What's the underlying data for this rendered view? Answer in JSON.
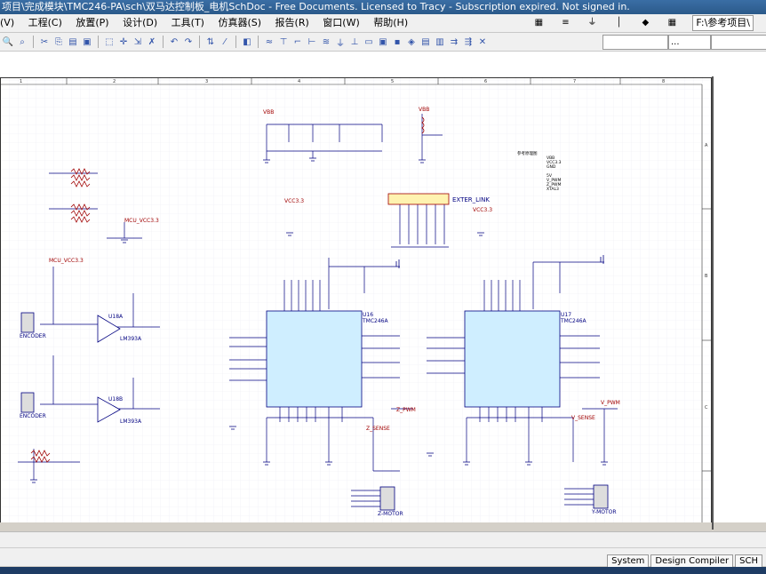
{
  "title": "项目\\完成模块\\TMC246-PA\\sch\\双马达控制板_电机SchDoc - Free Documents. Licensed to Tracy - Subscription expired. Not signed in.",
  "menu": [
    "(V)",
    "工程(C)",
    "放置(P)",
    "设计(D)",
    "工具(T)",
    "仿真器(S)",
    "报告(R)",
    "窗口(W)",
    "帮助(H)"
  ],
  "path_box": "F:\\参考项目\\",
  "combos": [
    "",
    "..."
  ],
  "sheet": {
    "col_numbers": [
      "1",
      "2",
      "3",
      "4",
      "5",
      "6",
      "7",
      "8"
    ],
    "row_letters": [
      "A",
      "B",
      "C"
    ],
    "exter_link": "EXTER_LINK",
    "note_lines": [
      "参考原理图",
      "VBB",
      "VCC3.3",
      "GND",
      "5V",
      "V_PWM",
      "Z_PWM",
      "XTAL3"
    ],
    "chip_labels": [
      "TMC246A",
      "TMC246A"
    ],
    "chip_refs": [
      "U16",
      "U17"
    ],
    "conn_labels": [
      "ENCODER",
      "ENCODER",
      "Z-MOTOR",
      "Y-MOTOR"
    ],
    "opamp_labels": [
      "U18A",
      "U18B",
      "LM393A",
      "LM393A"
    ],
    "net_labels": [
      "VBB",
      "VBB",
      "MCU_VCC3.3",
      "MCU_VCC3.3",
      "VCC3.3",
      "VCC3.3",
      "Z_PWM",
      "V_PWM",
      "Z_SENSE",
      "V_SENSE"
    ]
  },
  "panel_tabs": [
    "System",
    "Design Compiler",
    "SCH"
  ],
  "colors": {
    "chip_fill": "#cfeeff",
    "wire": "#000080",
    "net": "#a00000",
    "grid": "#e8e8f0",
    "titlebar": "#2b5a8a"
  }
}
